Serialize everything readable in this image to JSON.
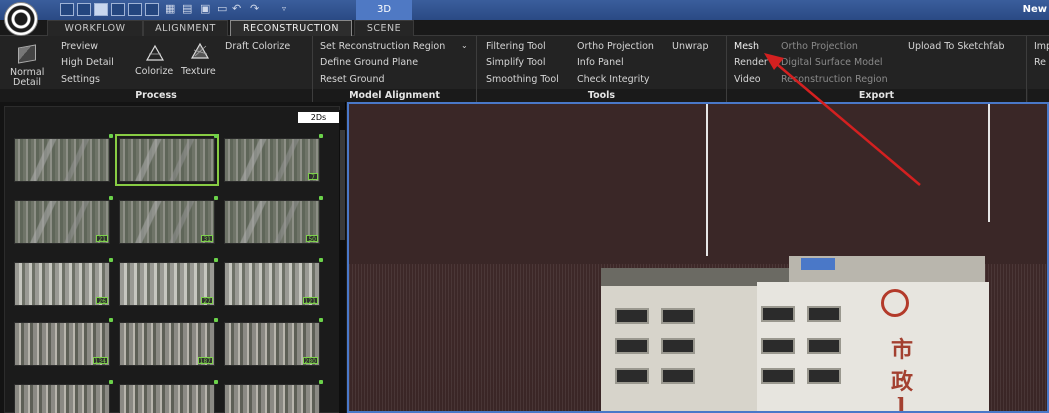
{
  "titlebar": {
    "view_label": "3D",
    "window_title": "New"
  },
  "tabs": [
    {
      "label": "WORKFLOW",
      "active": false
    },
    {
      "label": "ALIGNMENT",
      "active": false
    },
    {
      "label": "RECONSTRUCTION",
      "active": true
    },
    {
      "label": "SCENE",
      "active": false
    }
  ],
  "ribbon": {
    "process": {
      "group_label": "Process",
      "normal_detail_line1": "Normal",
      "normal_detail_line2": "Detail",
      "preview": "Preview",
      "high_detail": "High Detail",
      "settings": "Settings",
      "colorize": "Colorize",
      "texture": "Texture",
      "draft_colorize": "Draft Colorize"
    },
    "model_alignment": {
      "group_label": "Model Alignment",
      "set_region": "Set Reconstruction Region",
      "define_ground": "Define Ground Plane",
      "reset_ground": "Reset Ground"
    },
    "tools": {
      "group_label": "Tools",
      "filtering": "Filtering Tool",
      "simplify": "Simplify Tool",
      "smoothing": "Smoothing Tool",
      "ortho": "Ortho Projection",
      "info_panel": "Info Panel",
      "check_integrity": "Check Integrity",
      "unwrap": "Unwrap"
    },
    "export": {
      "group_label": "Export",
      "mesh": "Mesh",
      "render": "Render",
      "video": "Video",
      "ortho": "Ortho Projection",
      "dsm": "Digital Surface Model",
      "recon_region": "Reconstruction Region",
      "sketchfab": "Upload To Sketchfab"
    },
    "extra": {
      "imp": "Imp",
      "re": "Re"
    }
  },
  "left_panel": {
    "mode_tag": "2Ds",
    "thumbnails": [
      {
        "badge": "",
        "selected": false
      },
      {
        "badge": "",
        "selected": true
      },
      {
        "badge": "7",
        "selected": false
      },
      {
        "badge": "21",
        "selected": false
      },
      {
        "badge": "31",
        "selected": false
      },
      {
        "badge": "50",
        "selected": false
      },
      {
        "badge": "26",
        "selected": false
      },
      {
        "badge": "27",
        "selected": false
      },
      {
        "badge": "121",
        "selected": false
      },
      {
        "badge": "134",
        "selected": false
      },
      {
        "badge": "187",
        "selected": false
      },
      {
        "badge": "280",
        "selected": false
      },
      {
        "badge": "",
        "selected": false
      },
      {
        "badge": "",
        "selected": false
      },
      {
        "badge": "",
        "selected": false
      }
    ]
  },
  "viewport": {
    "sign_char_1": "市",
    "sign_char_2": "政",
    "sign_char_3": "l"
  },
  "colors": {
    "accent_blue": "#4a78c8",
    "selection_green": "#88cc44",
    "annotation_red": "#d42020"
  }
}
